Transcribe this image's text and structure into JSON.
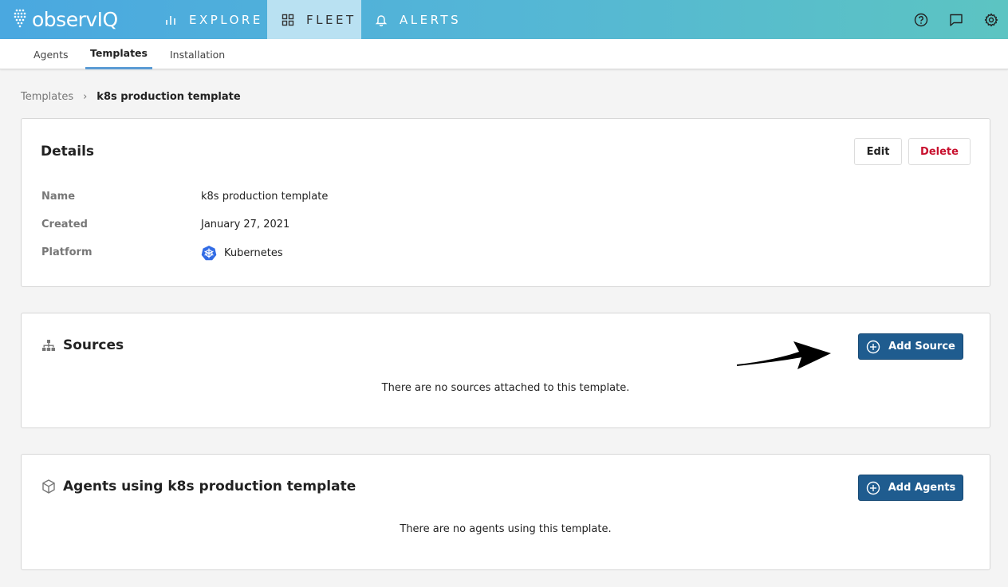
{
  "app": {
    "logo_text": "observIQ"
  },
  "nav": {
    "explore": "EXPLORE",
    "fleet": "FLEET",
    "alerts": "ALERTS"
  },
  "subnav": {
    "agents": "Agents",
    "templates": "Templates",
    "installation": "Installation"
  },
  "breadcrumb": {
    "parent": "Templates",
    "separator": "›",
    "current": "k8s production template"
  },
  "details": {
    "title": "Details",
    "edit_label": "Edit",
    "delete_label": "Delete",
    "rows": [
      {
        "label": "Name",
        "value": "k8s production template"
      },
      {
        "label": "Created",
        "value": "January 27, 2021"
      },
      {
        "label": "Platform",
        "value": "Kubernetes",
        "icon": "kubernetes-icon"
      }
    ]
  },
  "sources": {
    "title": "Sources",
    "add_label": "Add Source",
    "empty_text": "There are no sources attached to this template."
  },
  "agents_section": {
    "title": "Agents using k8s production template",
    "add_label": "Add Agents",
    "empty_text": "There are no agents using this template."
  },
  "colors": {
    "primary_button": "#1f5c8f",
    "delete_text": "#c8102e",
    "active_tab_underline": "#5a9bd4",
    "header_gradient_start": "#4aa8e0",
    "header_gradient_end": "#5cc4c2"
  }
}
